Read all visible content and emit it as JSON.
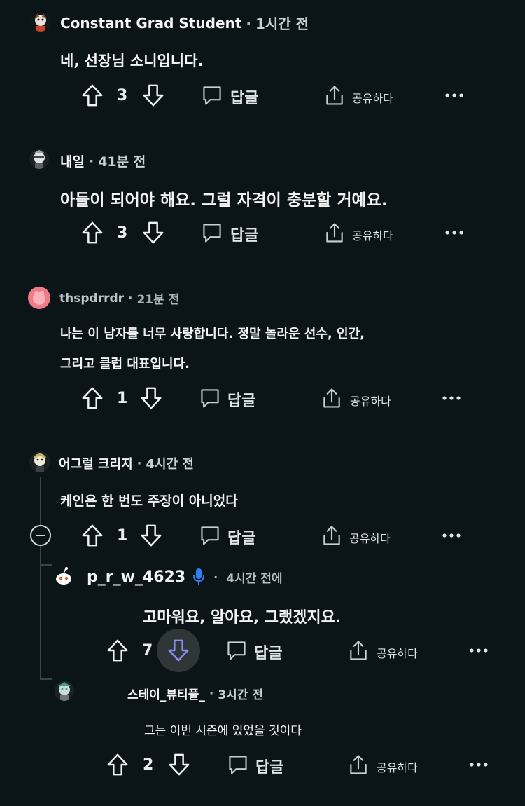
{
  "comments": [
    {
      "author": "Constant Grad Student",
      "time": "1시간 전",
      "body": [
        "네, 선장님 소니입니다."
      ],
      "votes": "3",
      "reply": "답글",
      "share": "공유하다"
    },
    {
      "author": "내일",
      "time": "41분 전",
      "body": [
        "아들이 되어야 해요. 그럴 자격이 충분할 거예요."
      ],
      "votes": "3",
      "reply": "답글",
      "share": "공유하다"
    },
    {
      "author": "thspdrrdr",
      "time": "21분 전",
      "body": [
        "나는 이 남자를 너무 사랑합니다. 정말 놀라운 선수, 인간,",
        "그리고 클럽 대표입니다."
      ],
      "votes": "1",
      "reply": "답글",
      "share": "공유하다"
    },
    {
      "author": "어그럴 크리지",
      "time": "4시간 전",
      "body": [
        "케인은 한 번도 주장이 아니었다"
      ],
      "votes": "1",
      "reply": "답글",
      "share": "공유하다"
    },
    {
      "author": "p_r_w_4623",
      "time": "4시간 전에",
      "body": [
        "고마워요, 알아요, 그랬겠지요."
      ],
      "votes": "7",
      "reply": "답글",
      "share": "공유하다"
    },
    {
      "author": "스테이_뷰티풀_",
      "time": "3시간 전",
      "body": [
        "그는 이번 시즌에 있었을 것이다"
      ],
      "votes": "2",
      "reply": "답글",
      "share": "공유하다"
    }
  ],
  "separator": "·",
  "icons": {
    "upvote": "upvote-arrow-icon",
    "downvote": "downvote-arrow-icon",
    "reply": "speech-bubble-icon",
    "share": "share-upload-icon",
    "more": "more-horizontal-icon",
    "mic": "microphone-icon",
    "collapse": "minus-circle-icon"
  },
  "colors": {
    "background": "#0b1416",
    "text": "#f2f4f5",
    "mic": "#2f7ff5",
    "downvote_active": "#8d8cf5"
  }
}
